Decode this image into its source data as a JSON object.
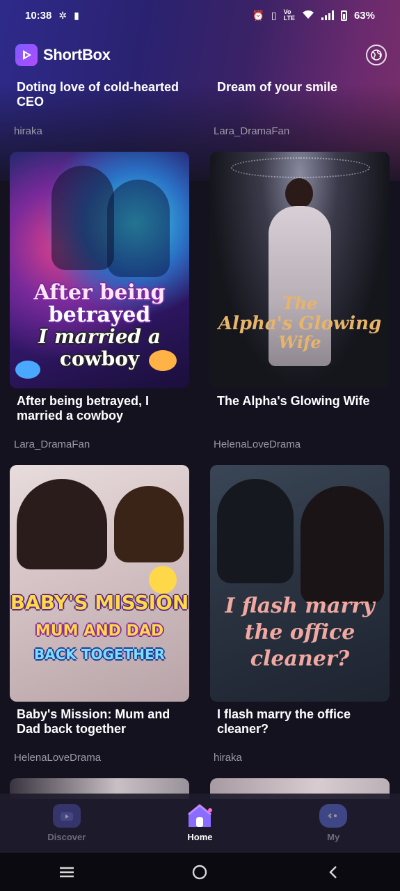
{
  "status_bar": {
    "time": "10:38",
    "battery": "63%"
  },
  "header": {
    "brand": "ShortBox"
  },
  "cards": [
    {
      "title": "Doting love of cold-hearted CEO",
      "author": "hiraka"
    },
    {
      "title": "Dream of your smile",
      "author": "Lara_DramaFan"
    },
    {
      "title": "After being betrayed, I married a cowboy",
      "author": "Lara_DramaFan",
      "poster_text": [
        "After being",
        "betrayed",
        "I married a",
        "cowboy"
      ]
    },
    {
      "title": "The Alpha's Glowing Wife",
      "author": "HelenaLoveDrama",
      "poster_text": [
        "The",
        "Alpha's Glowing",
        "Wife"
      ]
    },
    {
      "title": "Baby's Mission: Mum and Dad back together",
      "author": "HelenaLoveDrama",
      "poster_text": [
        "BABY'S MISSION",
        "MUM AND DAD",
        "BACK TOGETHER"
      ]
    },
    {
      "title": "I flash marry the office cleaner?",
      "author": "hiraka",
      "poster_text": [
        "I flash marry",
        "the office",
        "cleaner?"
      ]
    }
  ],
  "bottom_nav": [
    {
      "label": "Discover",
      "icon": "tv-icon",
      "active": false
    },
    {
      "label": "Home",
      "icon": "home-icon",
      "active": true
    },
    {
      "label": "My",
      "icon": "profile-icon",
      "active": false
    }
  ],
  "colors": {
    "accent": "#8b5cf6",
    "background": "#14121f",
    "author_text": "#9e9aa8"
  }
}
